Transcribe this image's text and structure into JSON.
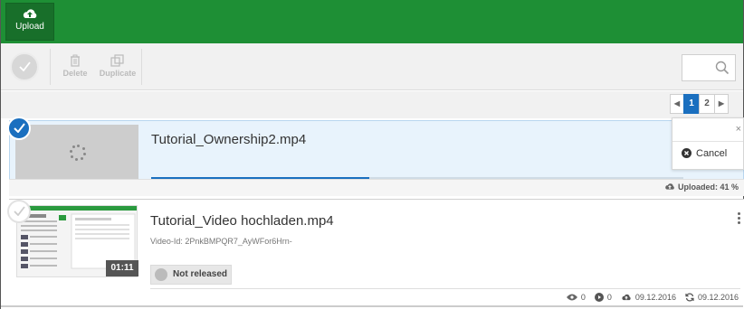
{
  "topbar": {
    "upload_label": "Upload"
  },
  "toolbar": {
    "delete_label": "Delete",
    "duplicate_label": "Duplicate"
  },
  "pager": {
    "pages": [
      "1",
      "2"
    ],
    "current": "1",
    "prev": "◀",
    "next": "▶"
  },
  "upload_item": {
    "title": "Tutorial_Ownership2.mp4",
    "progress_percent": 41,
    "status": "Uploaded: 41 %",
    "menu": {
      "close": "×",
      "cancel_label": "Cancel"
    }
  },
  "video_item": {
    "title": "Tutorial_Video hochladen.mp4",
    "video_id": "Video-Id: 2PnkBMPQR7_AyWFor6Hrn-",
    "duration": "01:11",
    "release_status": "Not released",
    "views": "0",
    "plays": "0",
    "uploaded_date": "09.12.2016",
    "updated_date": "09.12.2016"
  },
  "colors": {
    "brand_green": "#1e8f35",
    "accent_blue": "#1a6fbf"
  }
}
